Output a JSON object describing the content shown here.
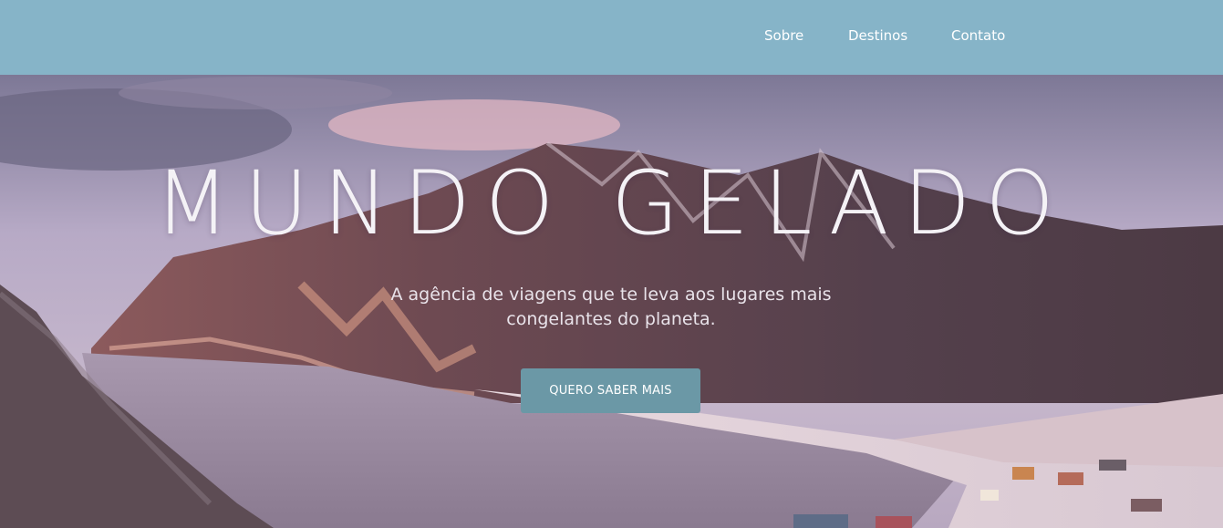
{
  "nav": {
    "items": [
      {
        "label": "Sobre"
      },
      {
        "label": "Destinos"
      },
      {
        "label": "Contato"
      }
    ]
  },
  "hero": {
    "title": "MUNDO GELADO",
    "subtitle": "A agência de viagens que te leva aos lugares mais congelantes do planeta.",
    "cta_label": "QUERO SABER MAIS"
  },
  "colors": {
    "navbar": "#86b4c8",
    "cta": "#6b98a6",
    "title": "#f4f2f6"
  }
}
